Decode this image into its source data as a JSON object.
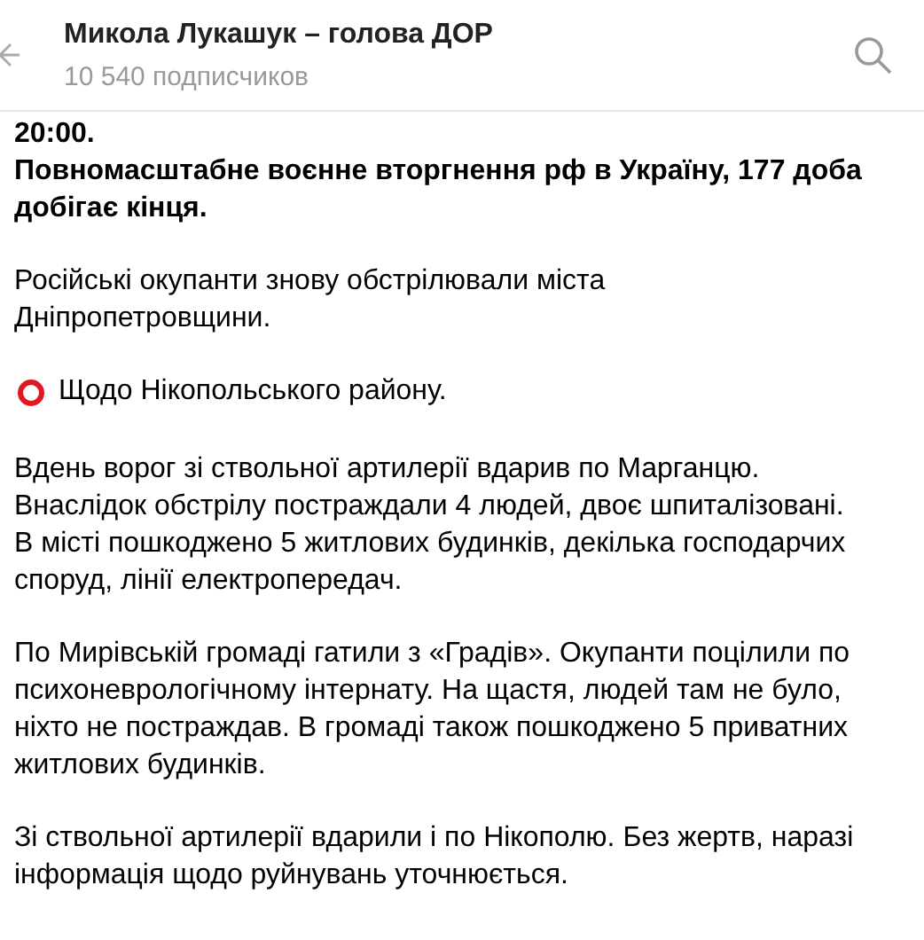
{
  "header": {
    "title": "Микола Лукашук – голова ДОР",
    "subtitle": "10 540 подписчиков"
  },
  "paragraphs": [
    {
      "kind": "bold",
      "text": "20:00.\nПовномасштабне воєнне вторгнення рф в Україну, 177 доба добігає кінця."
    },
    {
      "kind": "plain",
      "text": "Російські окупанти знову обстрілювали міста Дніпропетровщини."
    },
    {
      "kind": "marked",
      "text": "Щодо Нікопольського району."
    },
    {
      "kind": "plain",
      "text": "Вдень ворог зі ствольної артилерії вдарив по Марганцю. Внаслідок обстрілу постраждали 4 людей, двоє шпиталізовані. В місті пошкоджено 5 житлових будинків, декілька господарчих споруд, лінії електропередач."
    },
    {
      "kind": "plain",
      "text": "По Мирівській громаді гатили з «Градів». Окупанти поцілили по психоневрологічному інтернату. На щастя, людей там не було, ніхто не постраждав. В громаді також пошкоджено 5 приватних житлових будинків."
    },
    {
      "kind": "plain",
      "text": "Зі ствольної артилерії вдарили і по Нікополю. Без жертв, наразі інформація щодо руйнувань уточнюється."
    }
  ]
}
